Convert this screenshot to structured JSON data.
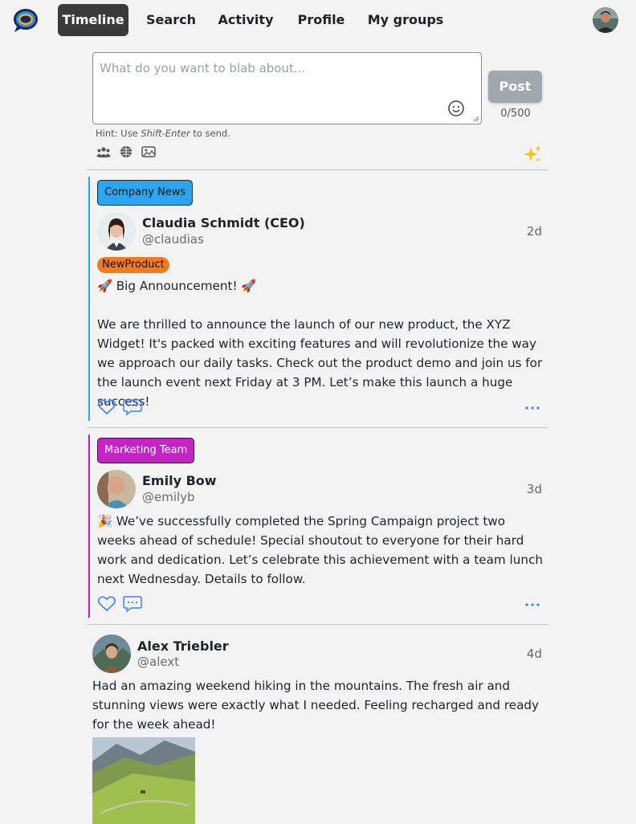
{
  "nav": {
    "tabs": [
      {
        "label": "Timeline",
        "active": true
      },
      {
        "label": "Search",
        "active": false
      },
      {
        "label": "Activity",
        "active": false
      },
      {
        "label": "Profile",
        "active": false
      },
      {
        "label": "My groups",
        "active": false
      }
    ]
  },
  "composer": {
    "placeholder": "What do you want to blab about...",
    "value": "",
    "post_label": "Post",
    "counter": "0/500",
    "hint_prefix": "Hint: Use ",
    "hint_key": "Shift-Enter",
    "hint_suffix": " to send.",
    "icons": [
      "group-icon",
      "globe-icon",
      "image-icon",
      "sparkle-icon",
      "emoji-icon"
    ]
  },
  "posts": [
    {
      "group": "Company News",
      "group_color": "#2ba6ee",
      "stripe_color": "#2ba6ee",
      "author": "Claudia Schmidt (CEO)",
      "handle": "@claudias",
      "time": "2d",
      "badge": "NewProduct",
      "badge_color": "#f37a1f",
      "text": "🚀 Big Announcement! 🚀\n\nWe are thrilled to announce the launch of our new product, the XYZ Widget! It's packed with exciting features and will revolutionize the way we approach our daily tasks. Check out the product demo and join us for the launch event next Friday at 3 PM. Let’s make this launch a huge success!"
    },
    {
      "group": "Marketing Team",
      "group_color": "#c424c4",
      "stripe_color": "#b42ab4",
      "author": "Emily Bow",
      "handle": "@emilyb",
      "time": "3d",
      "text": "🎉 We’ve successfully completed the Spring Campaign project two weeks ahead of schedule! Special shoutout to everyone for their hard work and dedication. Let’s celebrate this achievement with a team lunch next Wednesday. Details to follow."
    },
    {
      "author": "Alex Triebler",
      "handle": "@alext",
      "time": "4d",
      "text": "Had an amazing weekend hiking in the mountains. The fresh air and stunning views were exactly what I needed. Feeling recharged and ready for the week ahead!"
    }
  ],
  "colors": {
    "accent_blue": "#3b82f6",
    "active_tab": "#3a3a3a",
    "sparkle": "#f5c518"
  }
}
